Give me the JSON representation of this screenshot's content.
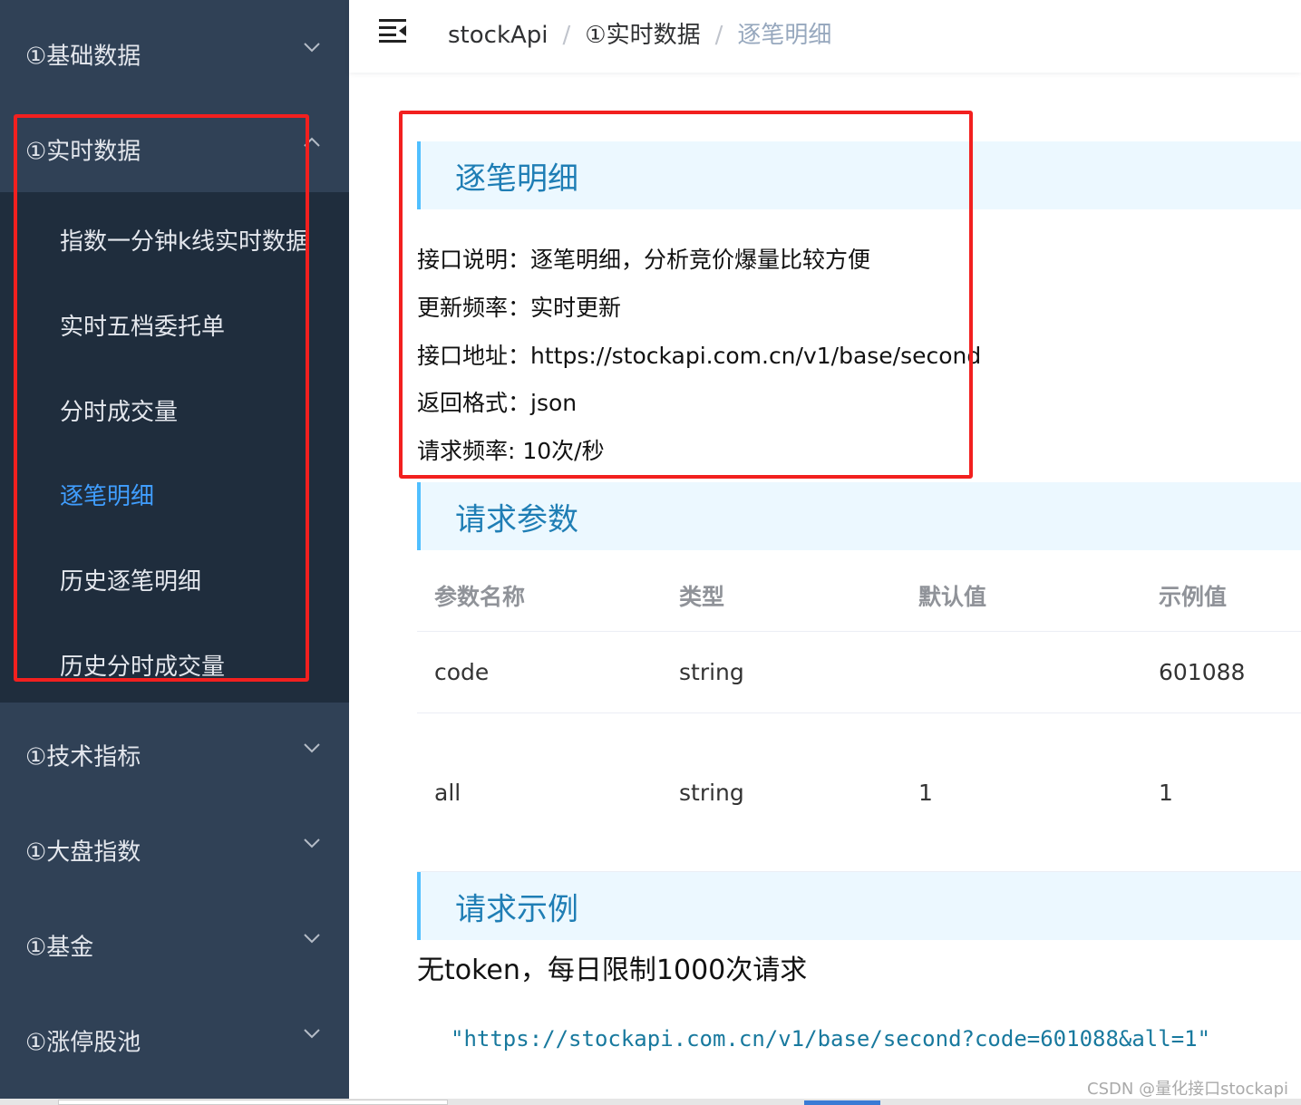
{
  "sidebar": {
    "groups": [
      {
        "label": "①基础数据",
        "expanded": false
      },
      {
        "label": "①实时数据",
        "expanded": true
      },
      {
        "label": "①技术指标",
        "expanded": false
      },
      {
        "label": "①大盘指数",
        "expanded": false
      },
      {
        "label": "①基金",
        "expanded": false
      },
      {
        "label": "①涨停股池",
        "expanded": false
      }
    ],
    "submenu_items": [
      {
        "label": "指数一分钟k线实时数据",
        "active": false
      },
      {
        "label": "实时五档委托单",
        "active": false
      },
      {
        "label": "分时成交量",
        "active": false
      },
      {
        "label": "逐笔明细",
        "active": true
      },
      {
        "label": "历史逐笔明细",
        "active": false
      },
      {
        "label": "历史分时成交量",
        "active": false
      }
    ]
  },
  "header": {
    "menu_icon": "hamburger-fold-icon",
    "breadcrumb": [
      "stockApi",
      "①实时数据",
      "逐笔明细"
    ],
    "separator": "/"
  },
  "main": {
    "section_detail": {
      "title": "逐笔明细",
      "lines": [
        "接口说明：逐笔明细，分析竞价爆量比较方便",
        "更新频率：实时更新",
        "接口地址：https://stockapi.com.cn/v1/base/second",
        "返回格式：json",
        "请求频率: 10次/秒"
      ]
    },
    "section_params": {
      "title": "请求参数",
      "columns": [
        "参数名称",
        "类型",
        "默认值",
        "示例值"
      ],
      "rows": [
        [
          "code",
          "string",
          "",
          "601088"
        ],
        [
          "all",
          "string",
          "1",
          "1"
        ]
      ]
    },
    "section_example": {
      "title": "请求示例",
      "note": "无token，每日限制1000次请求",
      "code": "\"https://stockapi.com.cn/v1/base/second?code=601088&all=1\""
    }
  },
  "watermark": "CSDN @量化接口stockapi",
  "colors": {
    "sidebar_bg": "#304156",
    "submenu_bg": "#1f2d3d",
    "active_item": "#409eff",
    "section_bg": "#ecf8ff",
    "section_border": "#50bfff",
    "annotation_red": "#f2201f"
  }
}
